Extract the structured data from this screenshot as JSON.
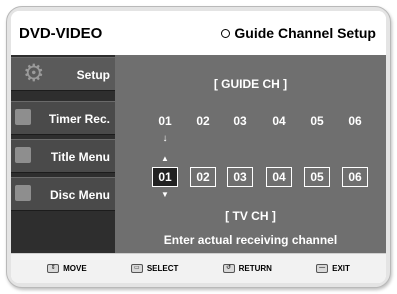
{
  "header": {
    "title": "DVD-VIDEO",
    "menu_title": "Guide Channel Setup"
  },
  "sidebar": {
    "items": [
      {
        "label": "Setup",
        "icon": "gear-icon"
      },
      {
        "label": "Timer Rec.",
        "icon": "timer-icon"
      },
      {
        "label": "Title Menu",
        "icon": "title-menu-icon"
      },
      {
        "label": "Disc Menu",
        "icon": "disc-menu-icon"
      }
    ]
  },
  "main": {
    "guide_heading": "[ GUIDE CH ]",
    "guide_channels": [
      "01",
      "02",
      "03",
      "04",
      "05",
      "06"
    ],
    "tv_channels": [
      "01",
      "02",
      "03",
      "04",
      "05",
      "06"
    ],
    "tv_heading": "[ TV CH ]",
    "instruction": "Enter actual receiving channel"
  },
  "footer": {
    "items": [
      {
        "label": "MOVE",
        "icon": "move-icon"
      },
      {
        "label": "SELECT",
        "icon": "select-icon"
      },
      {
        "label": "RETURN",
        "icon": "return-icon"
      },
      {
        "label": "EXIT",
        "icon": "exit-icon"
      }
    ]
  }
}
